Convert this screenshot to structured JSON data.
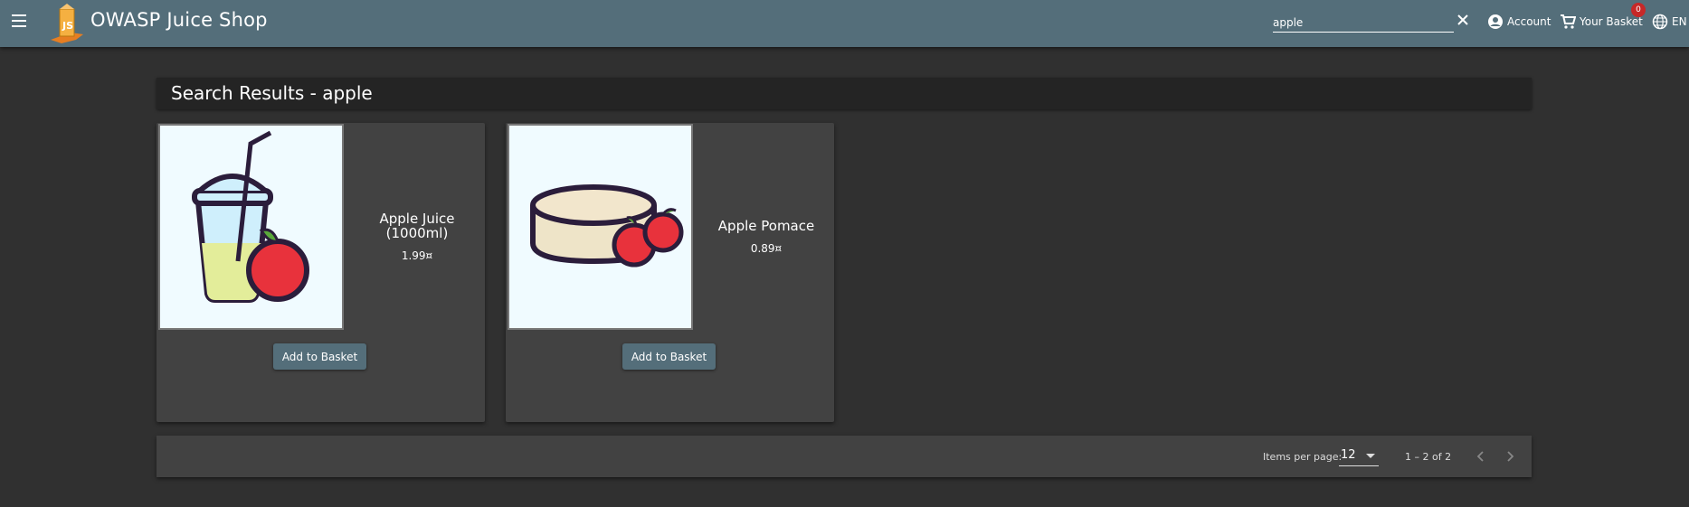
{
  "app": {
    "title": "OWASP Juice Shop"
  },
  "header": {
    "search_value": "apple",
    "account_label": "Account",
    "basket_label": "Your Basket",
    "basket_count": "0",
    "language_label": "EN"
  },
  "main": {
    "title": "Search Results - apple",
    "products": [
      {
        "name": "Apple Juice (1000ml)",
        "price": "1.99¤",
        "button": "Add to Basket",
        "image_icon": "apple-juice-icon"
      },
      {
        "name": "Apple Pomace",
        "price": "0.89¤",
        "button": "Add to Basket",
        "image_icon": "apple-pomace-icon"
      }
    ]
  },
  "paginator": {
    "items_per_page_label": "Items per page:",
    "items_per_page_value": "12",
    "range_label": "1 – 2 of 2"
  },
  "colors": {
    "toolbar": "#546e7a",
    "background": "#303030",
    "card": "#424242",
    "badge": "#c62828"
  }
}
